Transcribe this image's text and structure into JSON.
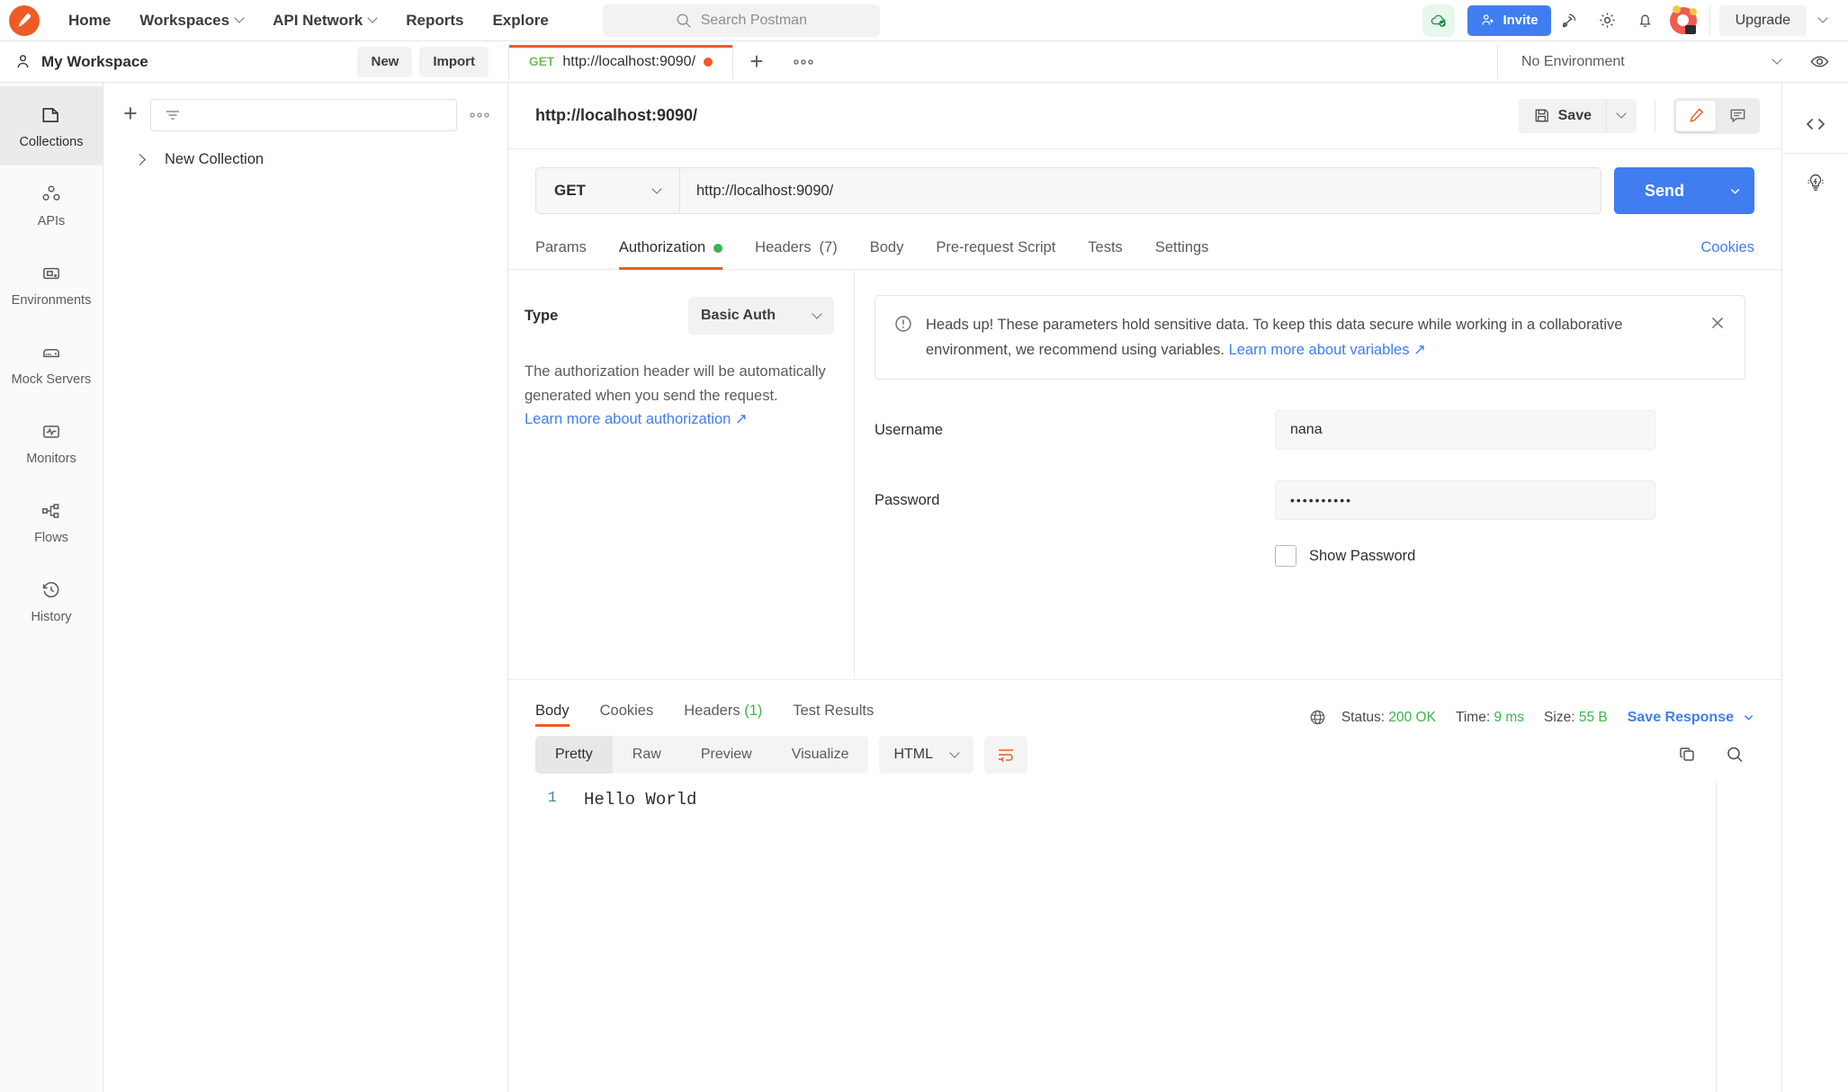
{
  "topbar": {
    "logo_icon": "postman-rocket-icon",
    "nav": [
      {
        "label": "Home",
        "icon": "",
        "caret": false
      },
      {
        "label": "Workspaces",
        "icon": "",
        "caret": true
      },
      {
        "label": "API Network",
        "icon": "",
        "caret": true
      },
      {
        "label": "Reports",
        "icon": "",
        "caret": false
      },
      {
        "label": "Explore",
        "icon": "",
        "caret": false
      }
    ],
    "search_placeholder": "Search Postman",
    "search_icon": "search-icon",
    "sync_icon": "cloud-check-icon",
    "invite_label": "Invite",
    "invite_icon": "user-plus-icon",
    "icons": [
      "satellite-icon",
      "gear-icon",
      "bell-icon"
    ],
    "avatar_icon": "user-avatar",
    "upgrade_label": "Upgrade",
    "accent_orange": "#ef5b25",
    "accent_blue": "#3f7df0",
    "accent_green": "#3cb54a"
  },
  "workspace": {
    "user_icon": "person-icon",
    "name": "My Workspace",
    "new_label": "New",
    "import_label": "Import"
  },
  "tabs": {
    "open": [
      {
        "method": "GET",
        "title": "http://localhost:9090/",
        "unsaved": true,
        "active": true
      }
    ],
    "add_icon": "plus-icon",
    "more_icon": "ellipsis-icon"
  },
  "environment": {
    "selected": "No Environment",
    "caret_icon": "chevron-down-icon",
    "eye_icon": "eye-icon"
  },
  "rail": {
    "items": [
      {
        "label": "Collections",
        "icon": "collections-icon",
        "active": true
      },
      {
        "label": "APIs",
        "icon": "apis-icon",
        "active": false
      },
      {
        "label": "Environments",
        "icon": "environments-icon",
        "active": false
      },
      {
        "label": "Mock Servers",
        "icon": "mock-servers-icon",
        "active": false
      },
      {
        "label": "Monitors",
        "icon": "monitors-icon",
        "active": false
      },
      {
        "label": "Flows",
        "icon": "flows-icon",
        "active": false
      },
      {
        "label": "History",
        "icon": "history-icon",
        "active": false
      }
    ]
  },
  "collections": {
    "add_icon": "plus-icon",
    "filter_icon": "filter-icon",
    "filter_placeholder": "",
    "more_icon": "ellipsis-icon",
    "items": [
      {
        "name": "New Collection",
        "expanded": false
      }
    ]
  },
  "request": {
    "title": "http://localhost:9090/",
    "save_label": "Save",
    "save_icon": "floppy-disk-icon",
    "save_caret_icon": "chevron-down-icon",
    "edit_icon": "pencil-icon",
    "comment_icon": "comment-icon",
    "method": "GET",
    "url": "http://localhost:9090/",
    "send_label": "Send",
    "send_caret_icon": "chevron-down-icon",
    "tabs": [
      {
        "label": "Params",
        "active": false,
        "badge": "",
        "dot": false
      },
      {
        "label": "Authorization",
        "active": true,
        "badge": "",
        "dot": true
      },
      {
        "label": "Headers",
        "active": false,
        "badge": "(7)",
        "dot": false
      },
      {
        "label": "Body",
        "active": false,
        "badge": "",
        "dot": false
      },
      {
        "label": "Pre-request Script",
        "active": false,
        "badge": "",
        "dot": false
      },
      {
        "label": "Tests",
        "active": false,
        "badge": "",
        "dot": false
      },
      {
        "label": "Settings",
        "active": false,
        "badge": "",
        "dot": false
      }
    ],
    "cookies_label": "Cookies"
  },
  "authorization": {
    "type_label": "Type",
    "type_value": "Basic Auth",
    "description": "The authorization header will be automatically generated when you send the request.",
    "learn_more": "Learn more about authorization ↗",
    "banner": {
      "icon": "alert-circle-icon",
      "text": "Heads up! These parameters hold sensitive data. To keep this data secure while working in a collaborative environment, we recommend using variables. ",
      "link": "Learn more about variables ↗",
      "close_icon": "close-icon"
    },
    "username_label": "Username",
    "username_value": "nana",
    "password_label": "Password",
    "password_value": "••••••••••",
    "show_password_label": "Show Password",
    "show_password_checked": false
  },
  "response": {
    "tabs": [
      {
        "label": "Body",
        "badge": "",
        "active": true
      },
      {
        "label": "Cookies",
        "badge": "",
        "active": false
      },
      {
        "label": "Headers",
        "badge": "(1)",
        "active": false
      },
      {
        "label": "Test Results",
        "badge": "",
        "active": false
      }
    ],
    "globe_icon": "globe-icon",
    "status_label": "Status:",
    "status_value": "200 OK",
    "time_label": "Time:",
    "time_value": "9 ms",
    "size_label": "Size:",
    "size_value": "55 B",
    "save_response_label": "Save Response",
    "save_response_caret": "chevron-down-icon",
    "view_modes": [
      {
        "label": "Pretty",
        "active": true
      },
      {
        "label": "Raw",
        "active": false
      },
      {
        "label": "Preview",
        "active": false
      },
      {
        "label": "Visualize",
        "active": false
      }
    ],
    "format": "HTML",
    "wrap_icon": "word-wrap-icon",
    "copy_icon": "copy-icon",
    "search_icon": "search-icon",
    "line_numbers": [
      "1"
    ],
    "body_lines": [
      "Hello World"
    ]
  },
  "right_rail": {
    "items": [
      {
        "icon": "code-icon"
      },
      {
        "icon": "lightbulb-icon"
      }
    ]
  }
}
